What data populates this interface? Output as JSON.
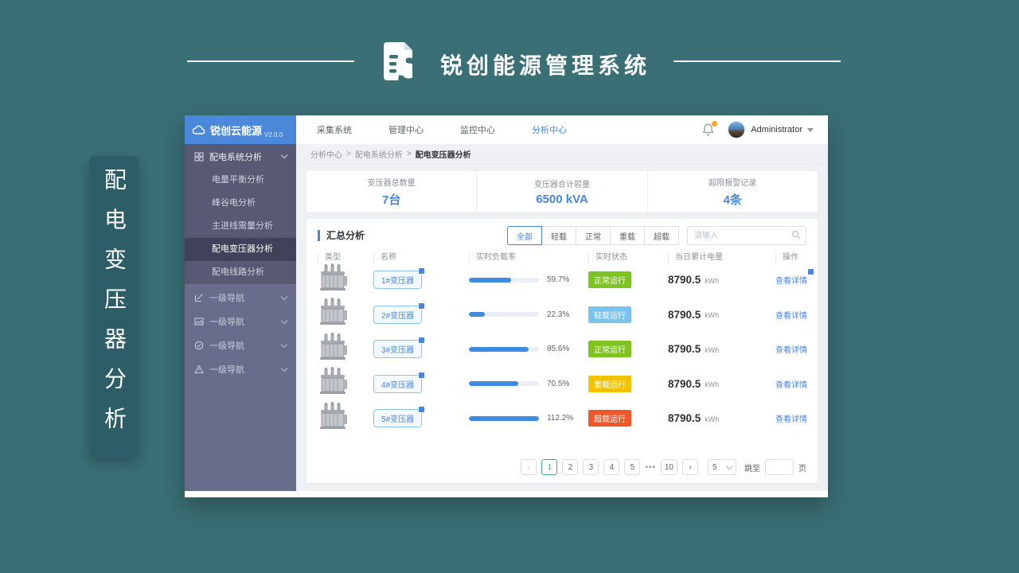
{
  "brand": {
    "title": "锐创能源管理系统",
    "side_label": "配电变压器分析"
  },
  "app": {
    "logo": {
      "name": "锐创云能源",
      "version": "V2.0.0"
    },
    "topnav": {
      "items": [
        "采集系统",
        "管理中心",
        "监控中心",
        "分析中心"
      ],
      "active": "分析中心"
    },
    "user": {
      "name": "Administrator"
    },
    "sidebar": {
      "group1_label": "配电系统分析",
      "submenu": [
        "电量平衡分析",
        "峰谷电分析",
        "主进线需量分析",
        "配电变压器分析",
        "配电线路分析"
      ],
      "active_item": "配电变压器分析",
      "nav_groups": [
        "一级导航",
        "一级导航",
        "一级导航",
        "一级导航"
      ]
    },
    "breadcrumb": {
      "items": [
        "分析中心",
        "配电系统分析",
        "配电变压器分析"
      ],
      "separator": ">"
    },
    "stats": [
      {
        "label": "变压器总数量",
        "value": "7台"
      },
      {
        "label": "变压器合计容量",
        "value": "6500 kVA"
      },
      {
        "label": "超限报警记录",
        "value": "4条"
      }
    ],
    "panel": {
      "title": "汇总分析",
      "filters": [
        "全部",
        "轻载",
        "正常",
        "重载",
        "超载"
      ],
      "active_filter": "全部",
      "search_placeholder": "请输入"
    },
    "table": {
      "headers": [
        "类型",
        "名称",
        "实时负载率",
        "实时状态",
        "当日累计电量",
        "操作"
      ],
      "rows": [
        {
          "name": "1#变压器",
          "load": "59.7%",
          "load_width": 59.7,
          "status": "正常运行",
          "status_color": "#7fc323",
          "energy": "8790.5",
          "unit": "kWh",
          "action": "查看详情"
        },
        {
          "name": "2#变压器",
          "load": "22.3%",
          "load_width": 22.3,
          "status": "轻载运行",
          "status_color": "#7ac3ee",
          "energy": "8790.5",
          "unit": "kWh",
          "action": "查看详情"
        },
        {
          "name": "3#变压器",
          "load": "85.6%",
          "load_width": 85.6,
          "status": "正常运行",
          "status_color": "#7fc323",
          "energy": "8790.5",
          "unit": "kWh",
          "action": "查看详情"
        },
        {
          "name": "4#变压器",
          "load": "70.5%",
          "load_width": 70.5,
          "status": "重载运行",
          "status_color": "#f3c301",
          "energy": "8790.5",
          "unit": "kWh",
          "action": "查看详情"
        },
        {
          "name": "5#变压器",
          "load": "112.2%",
          "load_width": 100,
          "status": "超载运行",
          "status_color": "#f2572c",
          "energy": "8790.5",
          "unit": "kWh",
          "action": "查看详情"
        }
      ]
    },
    "pagination": {
      "prev": "‹",
      "next": "›",
      "pages": [
        "1",
        "2",
        "3",
        "4",
        "5",
        "•••",
        "10"
      ],
      "active_page": "1",
      "page_size": "5",
      "jump_label": "跳至",
      "unit_label": "页"
    }
  },
  "colors": {
    "accent_blue": "#4a86d9",
    "teal_background": "#3a6f76",
    "green_status": "#7fc323",
    "lightblue_status": "#7ac3ee",
    "yellow_status": "#f3c301",
    "orange_status": "#f2572c"
  }
}
